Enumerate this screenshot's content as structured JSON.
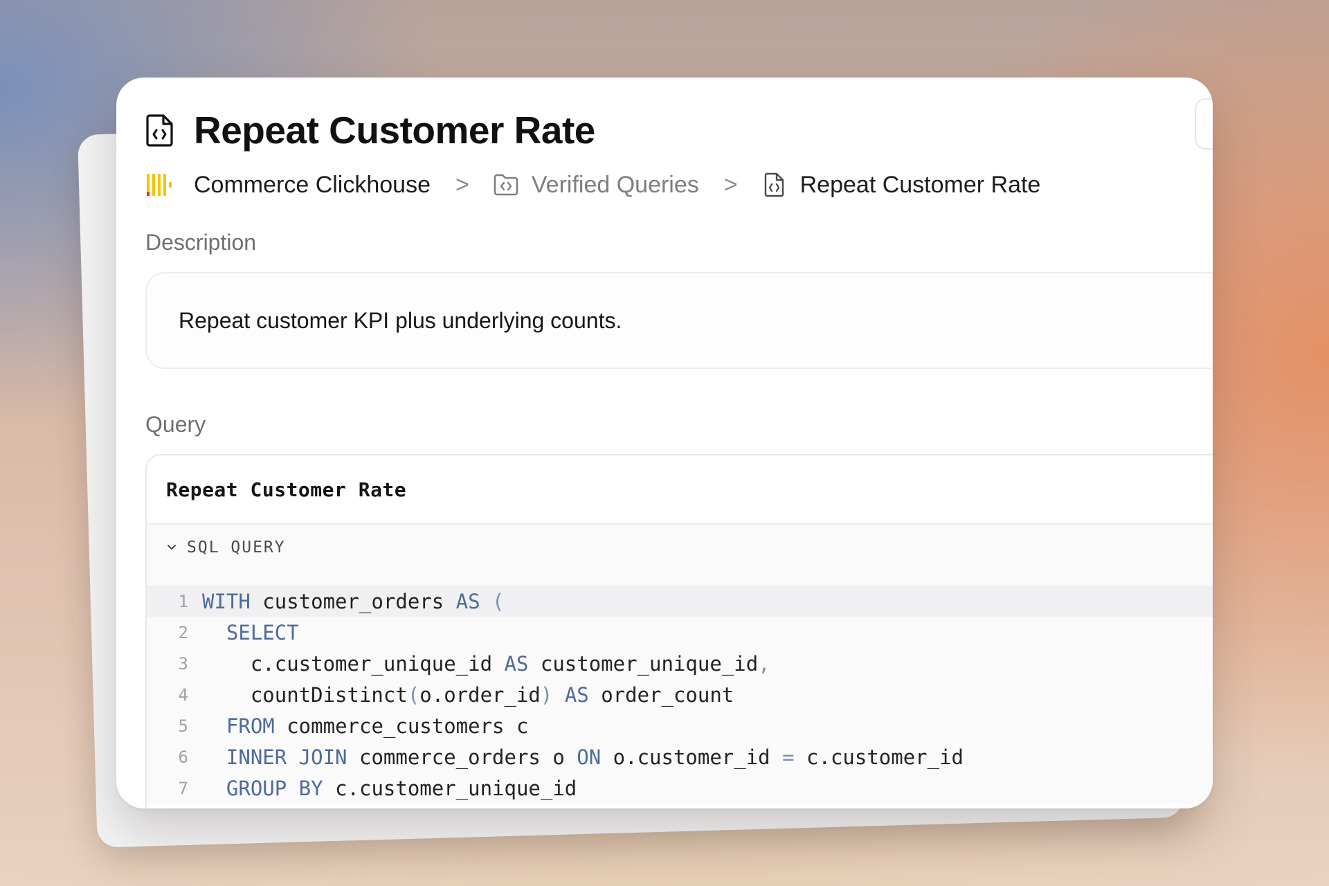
{
  "page": {
    "title": "Repeat Customer Rate"
  },
  "breadcrumb": {
    "items": [
      {
        "label": "Commerce Clickhouse",
        "icon": "clickhouse-logo"
      },
      {
        "label": "Verified Queries",
        "icon": "folder-code-icon"
      },
      {
        "label": "Repeat Customer Rate",
        "icon": "file-code-icon"
      }
    ],
    "separator": ">"
  },
  "description": {
    "label": "Description",
    "text": "Repeat customer KPI plus underlying counts."
  },
  "query": {
    "label": "Query",
    "name": "Repeat Customer Rate",
    "sql_toggle_label": "SQL QUERY",
    "lines": [
      {
        "n": "1",
        "tokens": [
          {
            "t": "WITH",
            "k": "kw"
          },
          {
            "t": " customer_orders ",
            "k": ""
          },
          {
            "t": "AS",
            "k": "kw"
          },
          {
            "t": " (",
            "k": "op"
          }
        ]
      },
      {
        "n": "2",
        "tokens": [
          {
            "t": "  ",
            "k": ""
          },
          {
            "t": "SELECT",
            "k": "kw"
          }
        ]
      },
      {
        "n": "3",
        "tokens": [
          {
            "t": "    c.customer_unique_id ",
            "k": ""
          },
          {
            "t": "AS",
            "k": "kw"
          },
          {
            "t": " customer_unique_id",
            "k": ""
          },
          {
            "t": ",",
            "k": "op"
          }
        ]
      },
      {
        "n": "4",
        "tokens": [
          {
            "t": "    countDistinct",
            "k": ""
          },
          {
            "t": "(",
            "k": "op"
          },
          {
            "t": "o.order_id",
            "k": ""
          },
          {
            "t": ")",
            "k": "op"
          },
          {
            "t": " ",
            "k": ""
          },
          {
            "t": "AS",
            "k": "kw"
          },
          {
            "t": " order_count",
            "k": ""
          }
        ]
      },
      {
        "n": "5",
        "tokens": [
          {
            "t": "  ",
            "k": ""
          },
          {
            "t": "FROM",
            "k": "kw"
          },
          {
            "t": " commerce_customers c",
            "k": ""
          }
        ]
      },
      {
        "n": "6",
        "tokens": [
          {
            "t": "  ",
            "k": ""
          },
          {
            "t": "INNER JOIN",
            "k": "kw"
          },
          {
            "t": " commerce_orders o ",
            "k": ""
          },
          {
            "t": "ON",
            "k": "kw"
          },
          {
            "t": " o.customer_id ",
            "k": ""
          },
          {
            "t": "=",
            "k": "op"
          },
          {
            "t": " c.customer_id",
            "k": ""
          }
        ]
      },
      {
        "n": "7",
        "tokens": [
          {
            "t": "  ",
            "k": ""
          },
          {
            "t": "GROUP BY",
            "k": "kw"
          },
          {
            "t": " c.customer_unique_id",
            "k": ""
          }
        ]
      }
    ]
  },
  "colors": {
    "keyword": "#4e6b9a",
    "operator": "#7e8fb3",
    "clickhouse_yellow": "#f5c400",
    "clickhouse_red": "#e2352a"
  }
}
